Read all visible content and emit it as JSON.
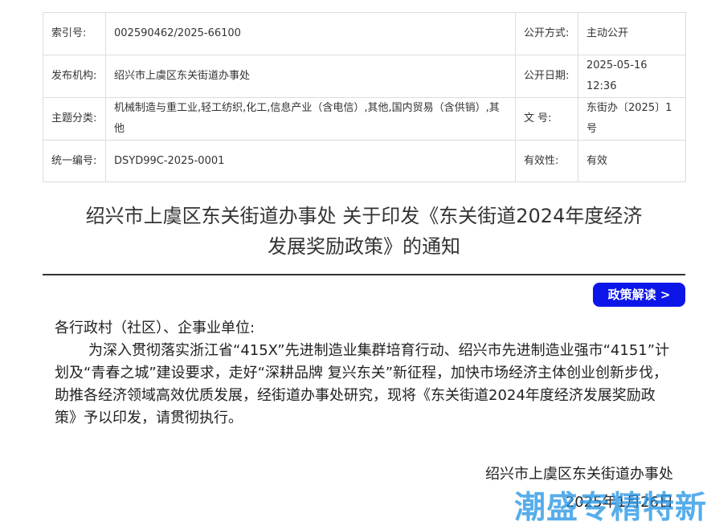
{
  "meta": {
    "rows": [
      {
        "l1": "索引号:",
        "v1": "002590462/2025-66100",
        "l2": "公开方式:",
        "v2": "主动公开"
      },
      {
        "l1": "发布机构:",
        "v1": "绍兴市上虞区东关街道办事处",
        "l2": "公开日期:",
        "v2": "2025-05-16 12:36"
      },
      {
        "l1": "主题分类:",
        "v1": "机械制造与重工业,轻工纺织,化工,信息产业（含电信）,其他,国内贸易（含供销）,其他",
        "l2": "文 号:",
        "v2": "东街办〔2025〕1号"
      },
      {
        "l1": "统一编号:",
        "v1": "DSYD99C-2025-0001",
        "l2": "有效性:",
        "v2": "有效"
      }
    ]
  },
  "title_line1": "绍兴市上虞区东关街道办事处 关于印发《东关街道2024年度经济",
  "title_line2": "发展奖励政策》的通知",
  "policy_button": "政策解读 >",
  "salutation": "各行政村（社区）、企事业单位:",
  "paragraph": "为深入贯彻落实浙江省“415X”先进制造业集群培育行动、绍兴市先进制造业强市“4151”计划及“青春之城”建设要求，走好“深耕品牌 复兴东关”新征程，加快市场经济主体创业创新步伐，助推各经济领域高效优质发展，经街道办事处研究，现将《东关街道2024年度经济发展奖励政策》予以印发，请贯彻执行。",
  "signature": "绍兴市上虞区东关街道办事处",
  "date": "2025年1月26日",
  "watermark": "潮盛专精特新",
  "colors": {
    "button": "#0c16e8",
    "watermark": "#2896e6"
  }
}
